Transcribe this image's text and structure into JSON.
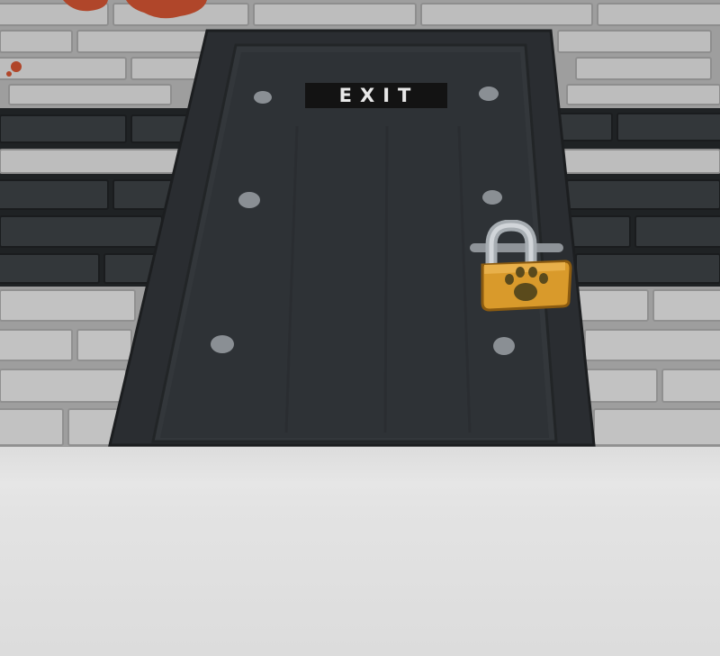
{
  "scene": {
    "exit_sign": "EXIT",
    "door": {
      "state": "locked"
    },
    "padlock": {
      "icon": "paw-print-icon",
      "color": "#d99a2b"
    },
    "colors": {
      "brick_light": "#b9b9b9",
      "brick_dark": "#2a2d2f",
      "mortar": "#9b9b9b",
      "door_body": "#2e3236",
      "door_frame": "#3b3f43",
      "floor": "#e2e2e2",
      "lock_shackle": "#c7c7c7",
      "paint_splatter": "#b0462a"
    }
  }
}
